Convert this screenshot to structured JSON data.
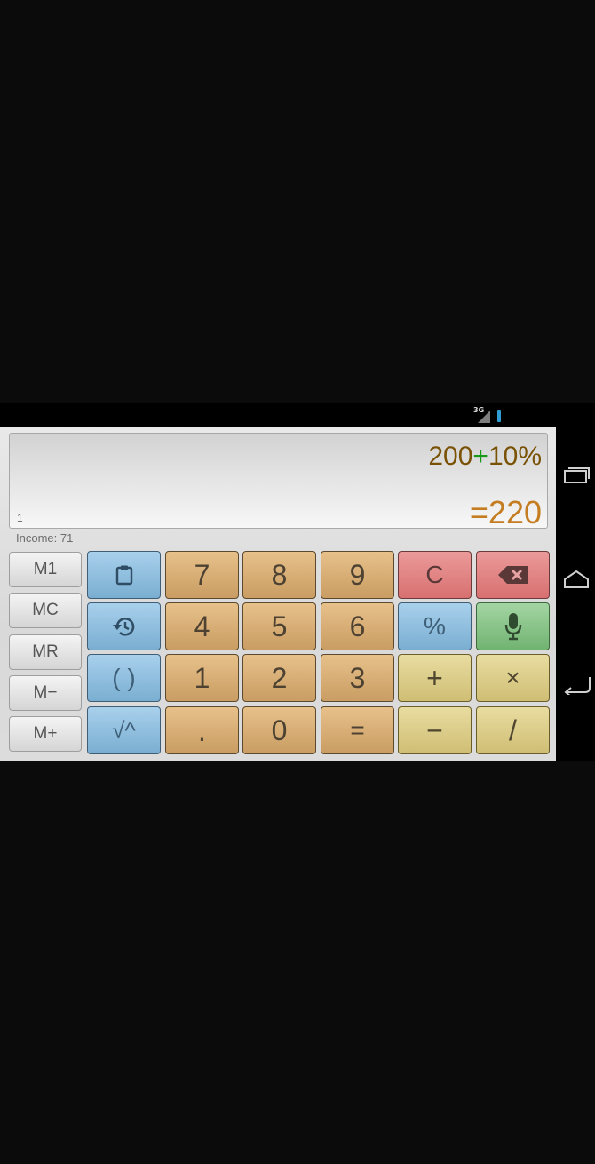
{
  "status_bar": {
    "network": "3G"
  },
  "display": {
    "expression_operand": "200",
    "expression_operator": "+",
    "expression_tail": "10%",
    "result": "=220",
    "line_number": "1"
  },
  "income_label": "Income: 71",
  "memory_keys": [
    "M1",
    "MC",
    "MR",
    "M−",
    "M+"
  ],
  "keys": {
    "row1": {
      "seven": "7",
      "eight": "8",
      "nine": "9",
      "clear": "C"
    },
    "row2": {
      "four": "4",
      "five": "5",
      "six": "6",
      "percent": "%"
    },
    "row3": {
      "parens": "( )",
      "one": "1",
      "two": "2",
      "three": "3",
      "plus": "+",
      "times": "×"
    },
    "row4": {
      "root_power": "√^",
      "dot": ".",
      "zero": "0",
      "equals": "=",
      "minus": "−",
      "divide": "/"
    }
  },
  "icons": {
    "clipboard": "clipboard-icon",
    "history": "history-icon",
    "backspace": "backspace-icon",
    "microphone": "microphone-icon",
    "recents": "recent-apps-icon",
    "home": "home-icon",
    "back": "back-icon"
  },
  "colors": {
    "expression": "#7a5206",
    "operator": "#179a17",
    "result": "#c57d22"
  }
}
